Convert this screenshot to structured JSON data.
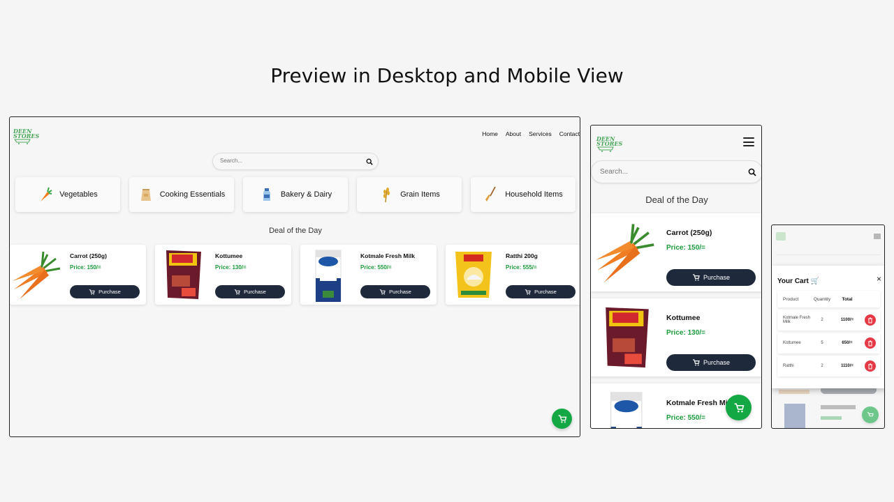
{
  "page": {
    "heading": "Preview in Desktop and Mobile View"
  },
  "logo": {
    "text_line1": "DEEN",
    "text_line2": "STORES"
  },
  "nav": {
    "items": [
      "Home",
      "About",
      "Services",
      "Contact"
    ]
  },
  "search": {
    "placeholder": "Search..."
  },
  "categories": [
    {
      "label": "Vegetables",
      "icon": "carrot-icon"
    },
    {
      "label": "Cooking Essentials",
      "icon": "sack-icon"
    },
    {
      "label": "Bakery & Dairy",
      "icon": "milk-bottle-icon"
    },
    {
      "label": "Grain Items",
      "icon": "wheat-icon"
    },
    {
      "label": "Household Items",
      "icon": "broom-icon"
    }
  ],
  "deal": {
    "title": "Deal of the Day"
  },
  "products": [
    {
      "name": "Carrot (250g)",
      "price": "Price: 150/="
    },
    {
      "name": "Kottumee",
      "price": "Price: 130/="
    },
    {
      "name": "Kotmale Fresh Milk",
      "price": "Price: 550/="
    },
    {
      "name": "Ratthi 200g",
      "price": "Price: 555/="
    }
  ],
  "purchase_label": "Purchase",
  "cart": {
    "title": "Your Cart 🛒",
    "close": "×",
    "headers": [
      "Product",
      "Quantity",
      "Total"
    ],
    "rows": [
      {
        "product": "Kotmale Fresh Milk",
        "quantity": "2",
        "total": "1100/="
      },
      {
        "product": "Kottumee",
        "quantity": "5",
        "total": "650/="
      },
      {
        "product": "Ratthi",
        "quantity": "2",
        "total": "1110/="
      }
    ]
  },
  "colors": {
    "accent_green": "#14a844",
    "button_dark": "#1e2a3b",
    "price_green": "#1a9a3a",
    "delete_red": "#e63946"
  }
}
